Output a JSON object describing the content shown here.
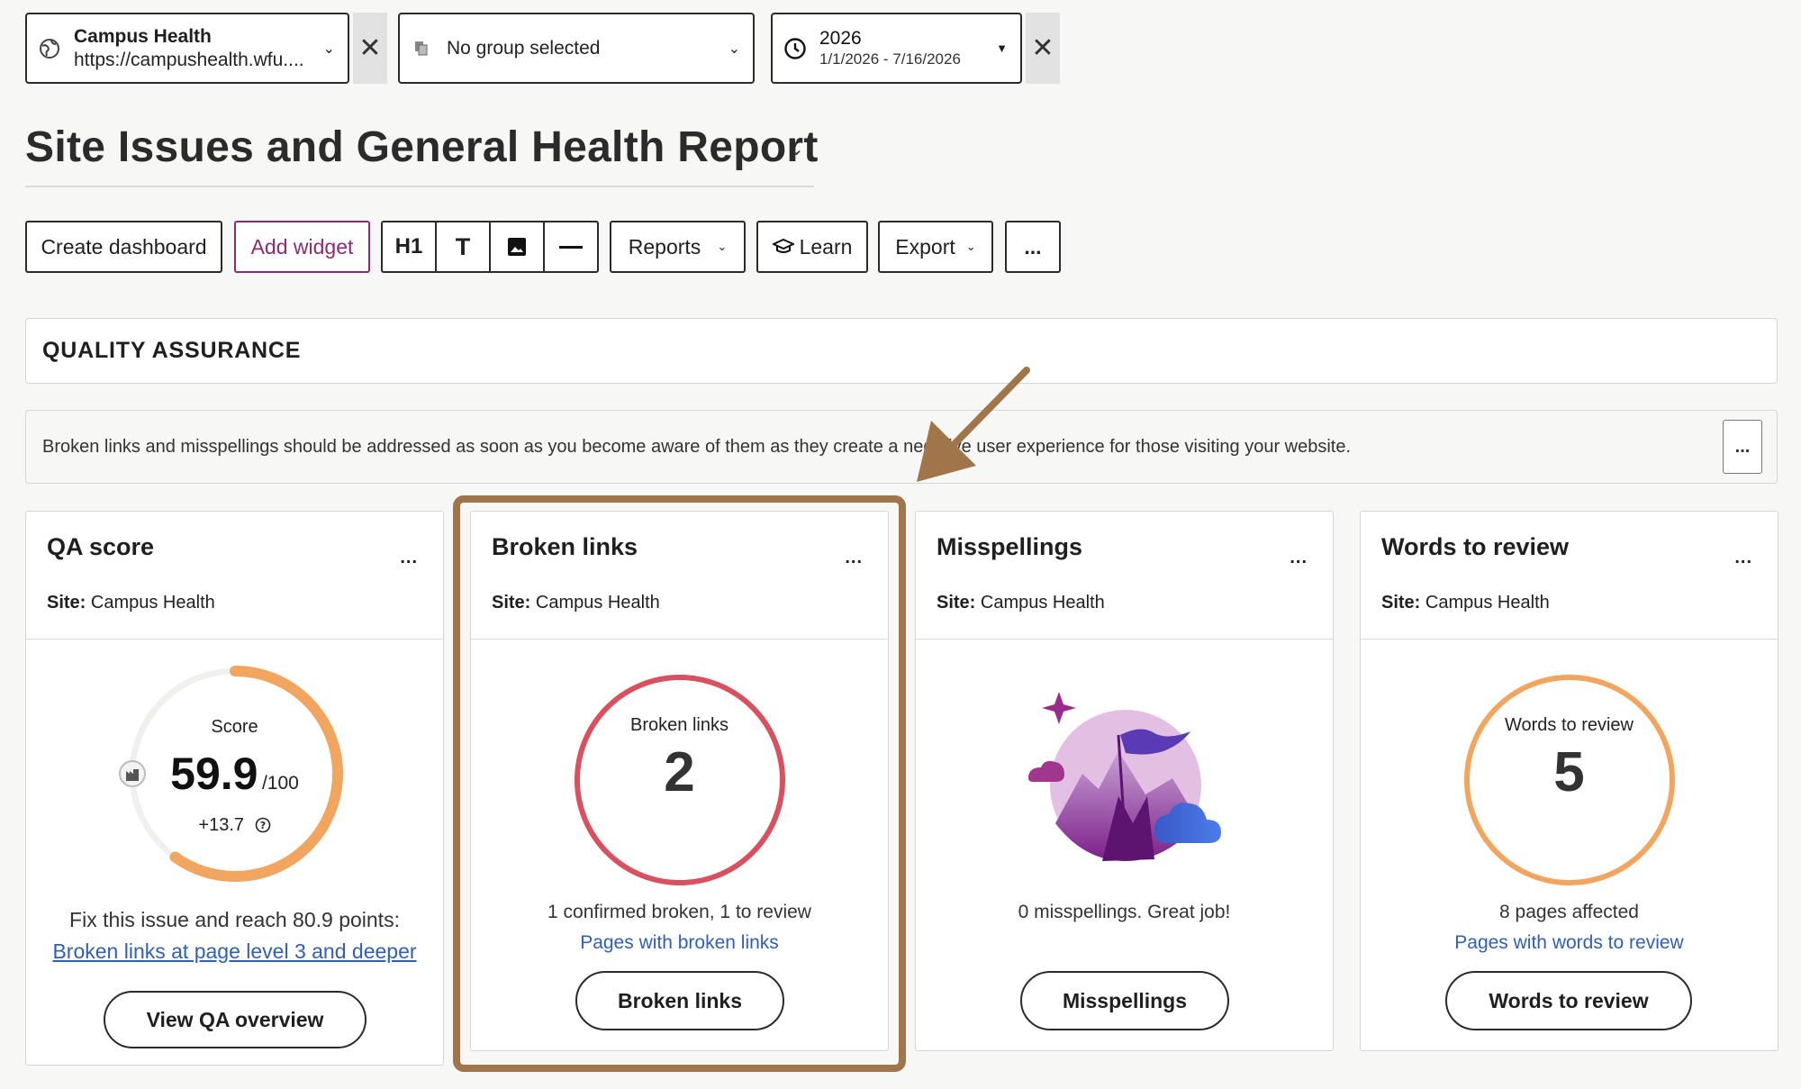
{
  "filters": {
    "site": {
      "name": "Campus Health",
      "url": "https://campushealth.wfu...."
    },
    "group": {
      "label": "No group selected"
    },
    "date": {
      "year": "2026",
      "range": "1/1/2026 - 7/16/2026"
    }
  },
  "page_title": "Site Issues and General Health Report",
  "toolbar": {
    "create_dashboard": "Create dashboard",
    "add_widget": "Add widget",
    "h1": "H1",
    "text": "T",
    "reports": "Reports",
    "learn": "Learn",
    "export": "Export",
    "more": "..."
  },
  "section": {
    "title": "QUALITY ASSURANCE",
    "note": "Broken links and misspellings should be addressed as soon as you become aware of them as they create a negative user experience for those visiting your website."
  },
  "widgets": {
    "qa_score": {
      "title": "QA score",
      "site_label": "Site:",
      "site_value": "Campus Health",
      "score_label": "Score",
      "score": "59.9",
      "score_max": "/100",
      "score_fraction": 0.599,
      "delta": "+13.7",
      "fix_text": "Fix this issue and reach 80.9 points:",
      "fix_link": "Broken links at page level 3 and deeper",
      "button": "View QA overview"
    },
    "broken_links": {
      "title": "Broken links",
      "site_label": "Site:",
      "site_value": "Campus Health",
      "ring_label": "Broken links",
      "value": "2",
      "summary": "1 confirmed broken, 1 to review",
      "link": "Pages with broken links",
      "button": "Broken links"
    },
    "misspellings": {
      "title": "Misspellings",
      "site_label": "Site:",
      "site_value": "Campus Health",
      "summary": "0 misspellings. Great job!",
      "button": "Misspellings"
    },
    "words_to_review": {
      "title": "Words to review",
      "site_label": "Site:",
      "site_value": "Campus Health",
      "ring_label": "Words to review",
      "value": "5",
      "summary": "8 pages affected",
      "link": "Pages with words to review",
      "button": "Words to review"
    },
    "more": "..."
  },
  "colors": {
    "accent_purple": "#8d2a74",
    "link_blue": "#2f5fb7",
    "score_orange": "#f2a55e",
    "broken_red": "#d9505e",
    "highlight_brown": "#a0754a"
  }
}
